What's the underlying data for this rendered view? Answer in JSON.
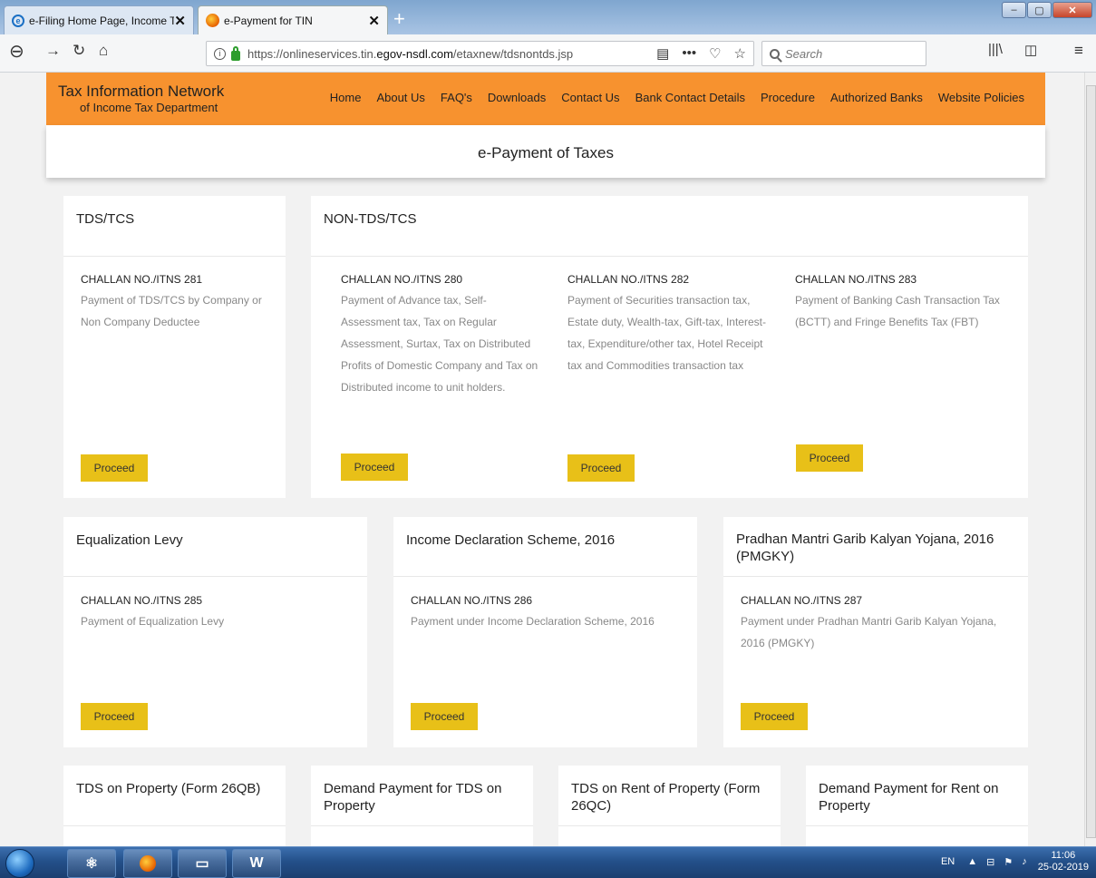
{
  "browser": {
    "tabs": [
      {
        "title": "e-Filing Home Page, Income T",
        "icon": "ie-icon",
        "active": false
      },
      {
        "title": "e-Payment for TIN",
        "icon": "firefox-icon",
        "active": true
      }
    ],
    "url_prefix": "https://onlineservices.tin.",
    "url_domain": "egov-nsdl.com",
    "url_suffix": "/etaxnew/tdsnontds.jsp",
    "search_placeholder": "Search"
  },
  "site": {
    "brand_line1": "Tax Information Network",
    "brand_line2": "of Income Tax Department",
    "menu": [
      "Home",
      "About Us",
      "FAQ's",
      "Downloads",
      "Contact Us",
      "Bank Contact Details",
      "Procedure",
      "Authorized Banks",
      "Website Policies"
    ],
    "page_title": "e-Payment of Taxes",
    "accent_color": "#f7922f",
    "button_color": "#e8c018"
  },
  "cards": {
    "tds": {
      "heading": "TDS/TCS",
      "code": "CHALLAN NO./ITNS 281",
      "desc": "Payment of TDS/TCS by Company or Non Company Deductee",
      "button": "Proceed"
    },
    "nontds": {
      "heading": "NON-TDS/TCS",
      "items": [
        {
          "code": "CHALLAN NO./ITNS 280",
          "desc": "Payment of Advance tax, Self-Assessment tax, Tax on Regular Assessment, Surtax, Tax on Distributed Profits of Domestic Company and Tax on Distributed income to unit holders.",
          "button": "Proceed"
        },
        {
          "code": "CHALLAN NO./ITNS 282",
          "desc": "Payment of Securities transaction tax, Estate duty, Wealth-tax, Gift-tax, Interest-tax, Expenditure/other tax, Hotel Receipt tax and Commodities transaction tax",
          "button": "Proceed"
        },
        {
          "code": "CHALLAN NO./ITNS 283",
          "desc": "Payment of Banking Cash Transaction Tax (BCTT) and Fringe Benefits Tax (FBT)",
          "button": "Proceed"
        }
      ]
    },
    "levy": {
      "heading": "Equalization Levy",
      "code": "CHALLAN NO./ITNS 285",
      "desc": "Payment of Equalization Levy",
      "button": "Proceed"
    },
    "ids": {
      "heading": "Income Declaration Scheme, 2016",
      "code": "CHALLAN NO./ITNS 286",
      "desc": "Payment under Income Declaration Scheme, 2016",
      "button": "Proceed"
    },
    "pmgky": {
      "heading": "Pradhan Mantri Garib Kalyan Yojana, 2016 (PMGKY)",
      "code": "CHALLAN NO./ITNS 287",
      "desc": "Payment under Pradhan Mantri Garib Kalyan Yojana, 2016 (PMGKY)",
      "button": "Proceed"
    },
    "bottom": [
      "TDS on Property (Form 26QB)",
      "Demand Payment for TDS on Property",
      "TDS on Rent of Property (Form 26QC)",
      "Demand Payment for Rent on Property"
    ]
  },
  "taskbar": {
    "lang": "EN",
    "time": "11:06",
    "date": "25-02-2019"
  }
}
